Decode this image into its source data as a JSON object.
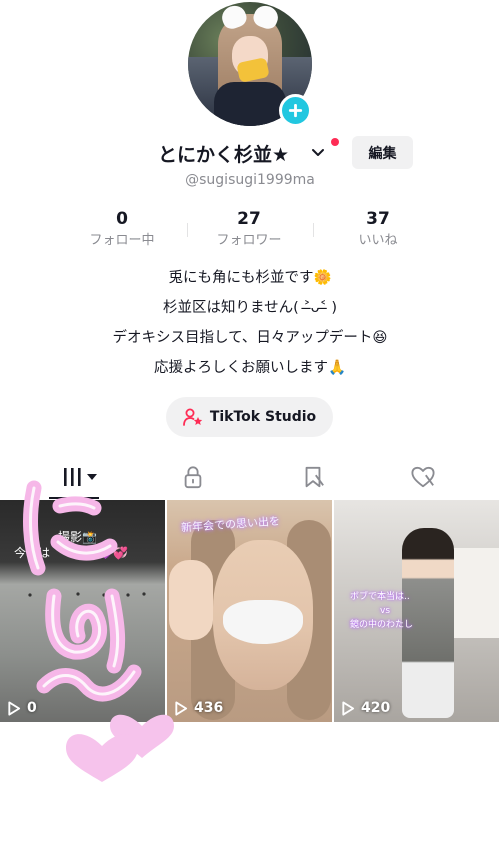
{
  "profile": {
    "username": "とにかく杉並★",
    "handle": "@sugisugi1999ma",
    "edit_label": "編集"
  },
  "stats": [
    {
      "value": "0",
      "label": "フォロー中"
    },
    {
      "value": "27",
      "label": "フォロワー"
    },
    {
      "value": "37",
      "label": "いいね"
    }
  ],
  "bio": [
    "兎にも角にも杉並です🌼",
    "杉並区は知りません( ˃̶ᴗ˂̶ )",
    "デオキシス目指して、日々アップデート😆",
    "応援よろしくお願いします🙏"
  ],
  "studio": {
    "label": "TikTok Studio"
  },
  "tabs": [
    {
      "icon": "grid-icon"
    },
    {
      "icon": "lock-icon"
    },
    {
      "icon": "bookmark-icon"
    },
    {
      "icon": "heart-icon"
    }
  ],
  "videos": [
    {
      "views": "0",
      "caption_a": "撮影📸",
      "caption_b": "今年は　　三昧💜💞"
    },
    {
      "views": "436",
      "caption": "新年会での思い出を"
    },
    {
      "views": "420",
      "caption_a": "ボブで本当は..",
      "caption_b": "vs",
      "caption_c": "鏡の中のわたし"
    }
  ],
  "colors": {
    "accent": "#22c7e0",
    "notification": "#fe2c55",
    "overlay_pink": "#f6b7e8",
    "text": "#161823",
    "muted": "#8a8b91"
  }
}
